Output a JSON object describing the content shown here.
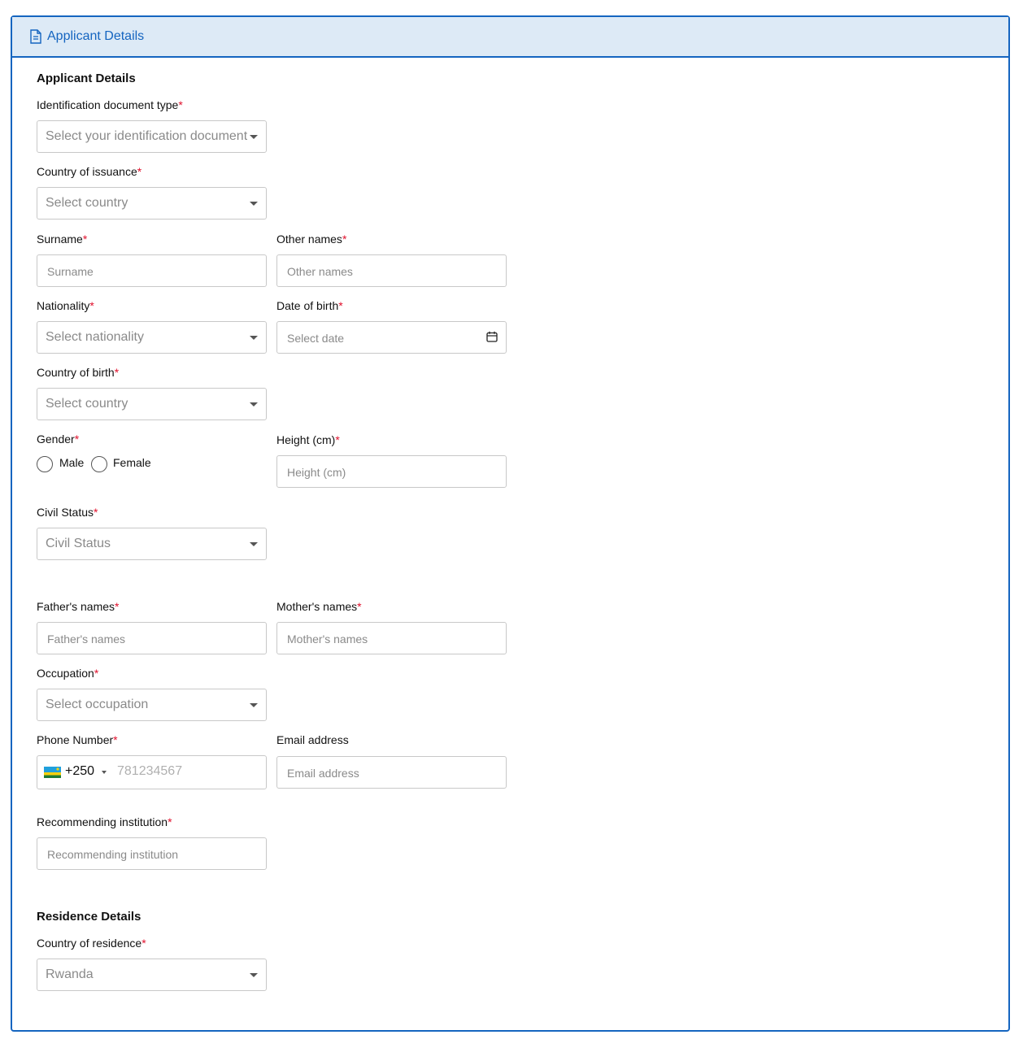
{
  "header": {
    "title": "Applicant Details",
    "icon": "document-icon"
  },
  "applicant": {
    "section_title": "Applicant Details",
    "id_type": {
      "label": "Identification document type",
      "placeholder": "Select your identification document"
    },
    "country_issuance": {
      "label": "Country of issuance",
      "placeholder": "Select country"
    },
    "surname": {
      "label": "Surname",
      "placeholder": "Surname"
    },
    "other_names": {
      "label": "Other names",
      "placeholder": "Other names"
    },
    "nationality": {
      "label": "Nationality",
      "placeholder": "Select nationality"
    },
    "dob": {
      "label": "Date of birth",
      "placeholder": "Select date"
    },
    "country_birth": {
      "label": "Country of birth",
      "placeholder": "Select country"
    },
    "gender": {
      "label": "Gender",
      "options": [
        "Male",
        "Female"
      ]
    },
    "height": {
      "label": "Height (cm)",
      "placeholder": "Height (cm)"
    },
    "civil_status": {
      "label": "Civil Status",
      "placeholder": "Civil Status"
    },
    "father": {
      "label": "Father's names",
      "placeholder": "Father's names"
    },
    "mother": {
      "label": "Mother's names",
      "placeholder": "Mother's names"
    },
    "occupation": {
      "label": "Occupation",
      "placeholder": "Select occupation"
    },
    "phone": {
      "label": "Phone Number",
      "country_code": "+250",
      "placeholder": "781234567",
      "flag": "rwanda-flag-icon"
    },
    "email": {
      "label": "Email address",
      "placeholder": "Email address"
    },
    "recommending": {
      "label": "Recommending institution",
      "placeholder": "Recommending institution"
    }
  },
  "residence": {
    "section_title": "Residence Details",
    "country": {
      "label": "Country of residence",
      "value": "Rwanda"
    }
  },
  "required_marker": "*",
  "colors": {
    "accent": "#1565c0",
    "header_bg": "#ddeaf6",
    "required": "#e0102c"
  }
}
